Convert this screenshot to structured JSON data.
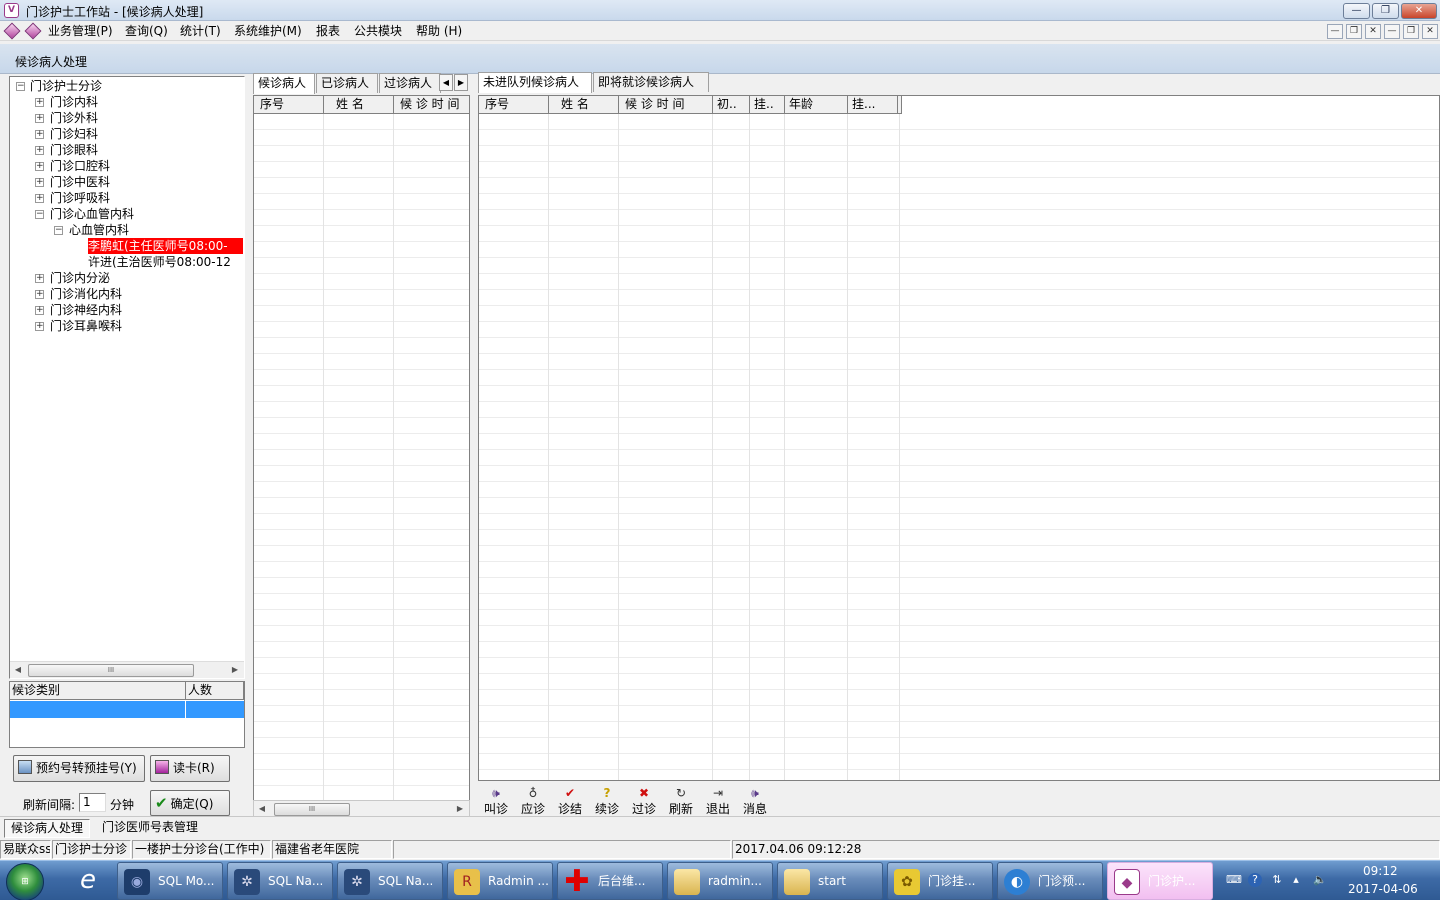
{
  "window": {
    "title": "门诊护士工作站 - [候诊病人处理]"
  },
  "menu": [
    "业务管理(P)",
    "查询(Q)",
    "统计(T)",
    "系统维护(M)",
    "报表",
    "公共模块",
    "帮助 (H)"
  ],
  "form_caption": "候诊病人处理",
  "tree": {
    "root": "门诊护士分诊",
    "departments": [
      "门诊内科",
      "门诊外科",
      "门诊妇科",
      "门诊眼科",
      "门诊口腔科",
      "门诊中医科",
      "门诊呼吸科",
      "门诊心血管内科"
    ],
    "sub_department": "心血管内科",
    "doctors": [
      "李鹏虹(主任医师号08:00-",
      "许进(主治医师号08:00-12"
    ],
    "departments_after": [
      "门诊内分泌",
      "门诊消化内科",
      "门诊神经内科",
      "门诊耳鼻喉科"
    ]
  },
  "category_grid": {
    "headers": [
      "候诊类别",
      "人数"
    ]
  },
  "buttons": {
    "convert": "预约号转预挂号(Y)",
    "read_card": "读卡(R)",
    "refresh_label": "刷新间隔:",
    "refresh_value": "1",
    "refresh_unit": "分钟",
    "confirm": "确定(Q)"
  },
  "middle": {
    "tabs": [
      "候诊病人",
      "已诊病人",
      "过诊病人"
    ],
    "columns": [
      "序号",
      "姓  名",
      "候 诊 时 间"
    ]
  },
  "right": {
    "tabs": [
      "未进队列候诊病人",
      "即将就诊候诊病人"
    ],
    "columns": [
      "序号",
      "姓  名",
      "候 诊 时 间",
      "初..",
      "挂..",
      "年龄",
      "挂..."
    ]
  },
  "toolbar": [
    {
      "label": "叫诊",
      "icon": "speaker-icon"
    },
    {
      "label": "应诊",
      "icon": "stethoscope-icon"
    },
    {
      "label": "诊结",
      "icon": "checkmark-icon"
    },
    {
      "label": "续诊",
      "icon": "question-icon"
    },
    {
      "label": "过诊",
      "icon": "cross-icon"
    },
    {
      "label": "刷新",
      "icon": "refresh-icon"
    },
    {
      "label": "退出",
      "icon": "exit-door-icon"
    },
    {
      "label": "消息",
      "icon": "message-speaker-icon"
    }
  ],
  "form_tabs": [
    "候诊病人处理",
    "门诊医师号表管理"
  ],
  "status": {
    "user": "易联众ss",
    "module": "门诊护士分诊",
    "station": "一楼护士分诊台(工作中)",
    "hospital": "福建省老年医院",
    "datetime": "2017.04.06 09:12:28"
  },
  "taskbar": {
    "items": [
      {
        "label": "SQL Mo...",
        "icon": "sql-monitor-icon"
      },
      {
        "label": "SQL Na...",
        "icon": "navicat-icon"
      },
      {
        "label": "SQL Na...",
        "icon": "navicat-icon"
      },
      {
        "label": "Radmin ...",
        "icon": "radmin-icon"
      },
      {
        "label": "后台维...",
        "icon": "red-cross-icon"
      },
      {
        "label": "radmin...",
        "icon": "folder-icon"
      },
      {
        "label": "start",
        "icon": "folder-icon"
      },
      {
        "label": "门诊挂...",
        "icon": "app-icon"
      },
      {
        "label": "门诊预...",
        "icon": "app-icon"
      },
      {
        "label": "门诊护...",
        "icon": "app-icon"
      }
    ],
    "time": "09:12",
    "date": "2017-04-06"
  },
  "colors": {
    "selected_doctor_bg": "#ff0000",
    "selected_row": "#3399ff",
    "taskbar": "#3d6aa6"
  }
}
